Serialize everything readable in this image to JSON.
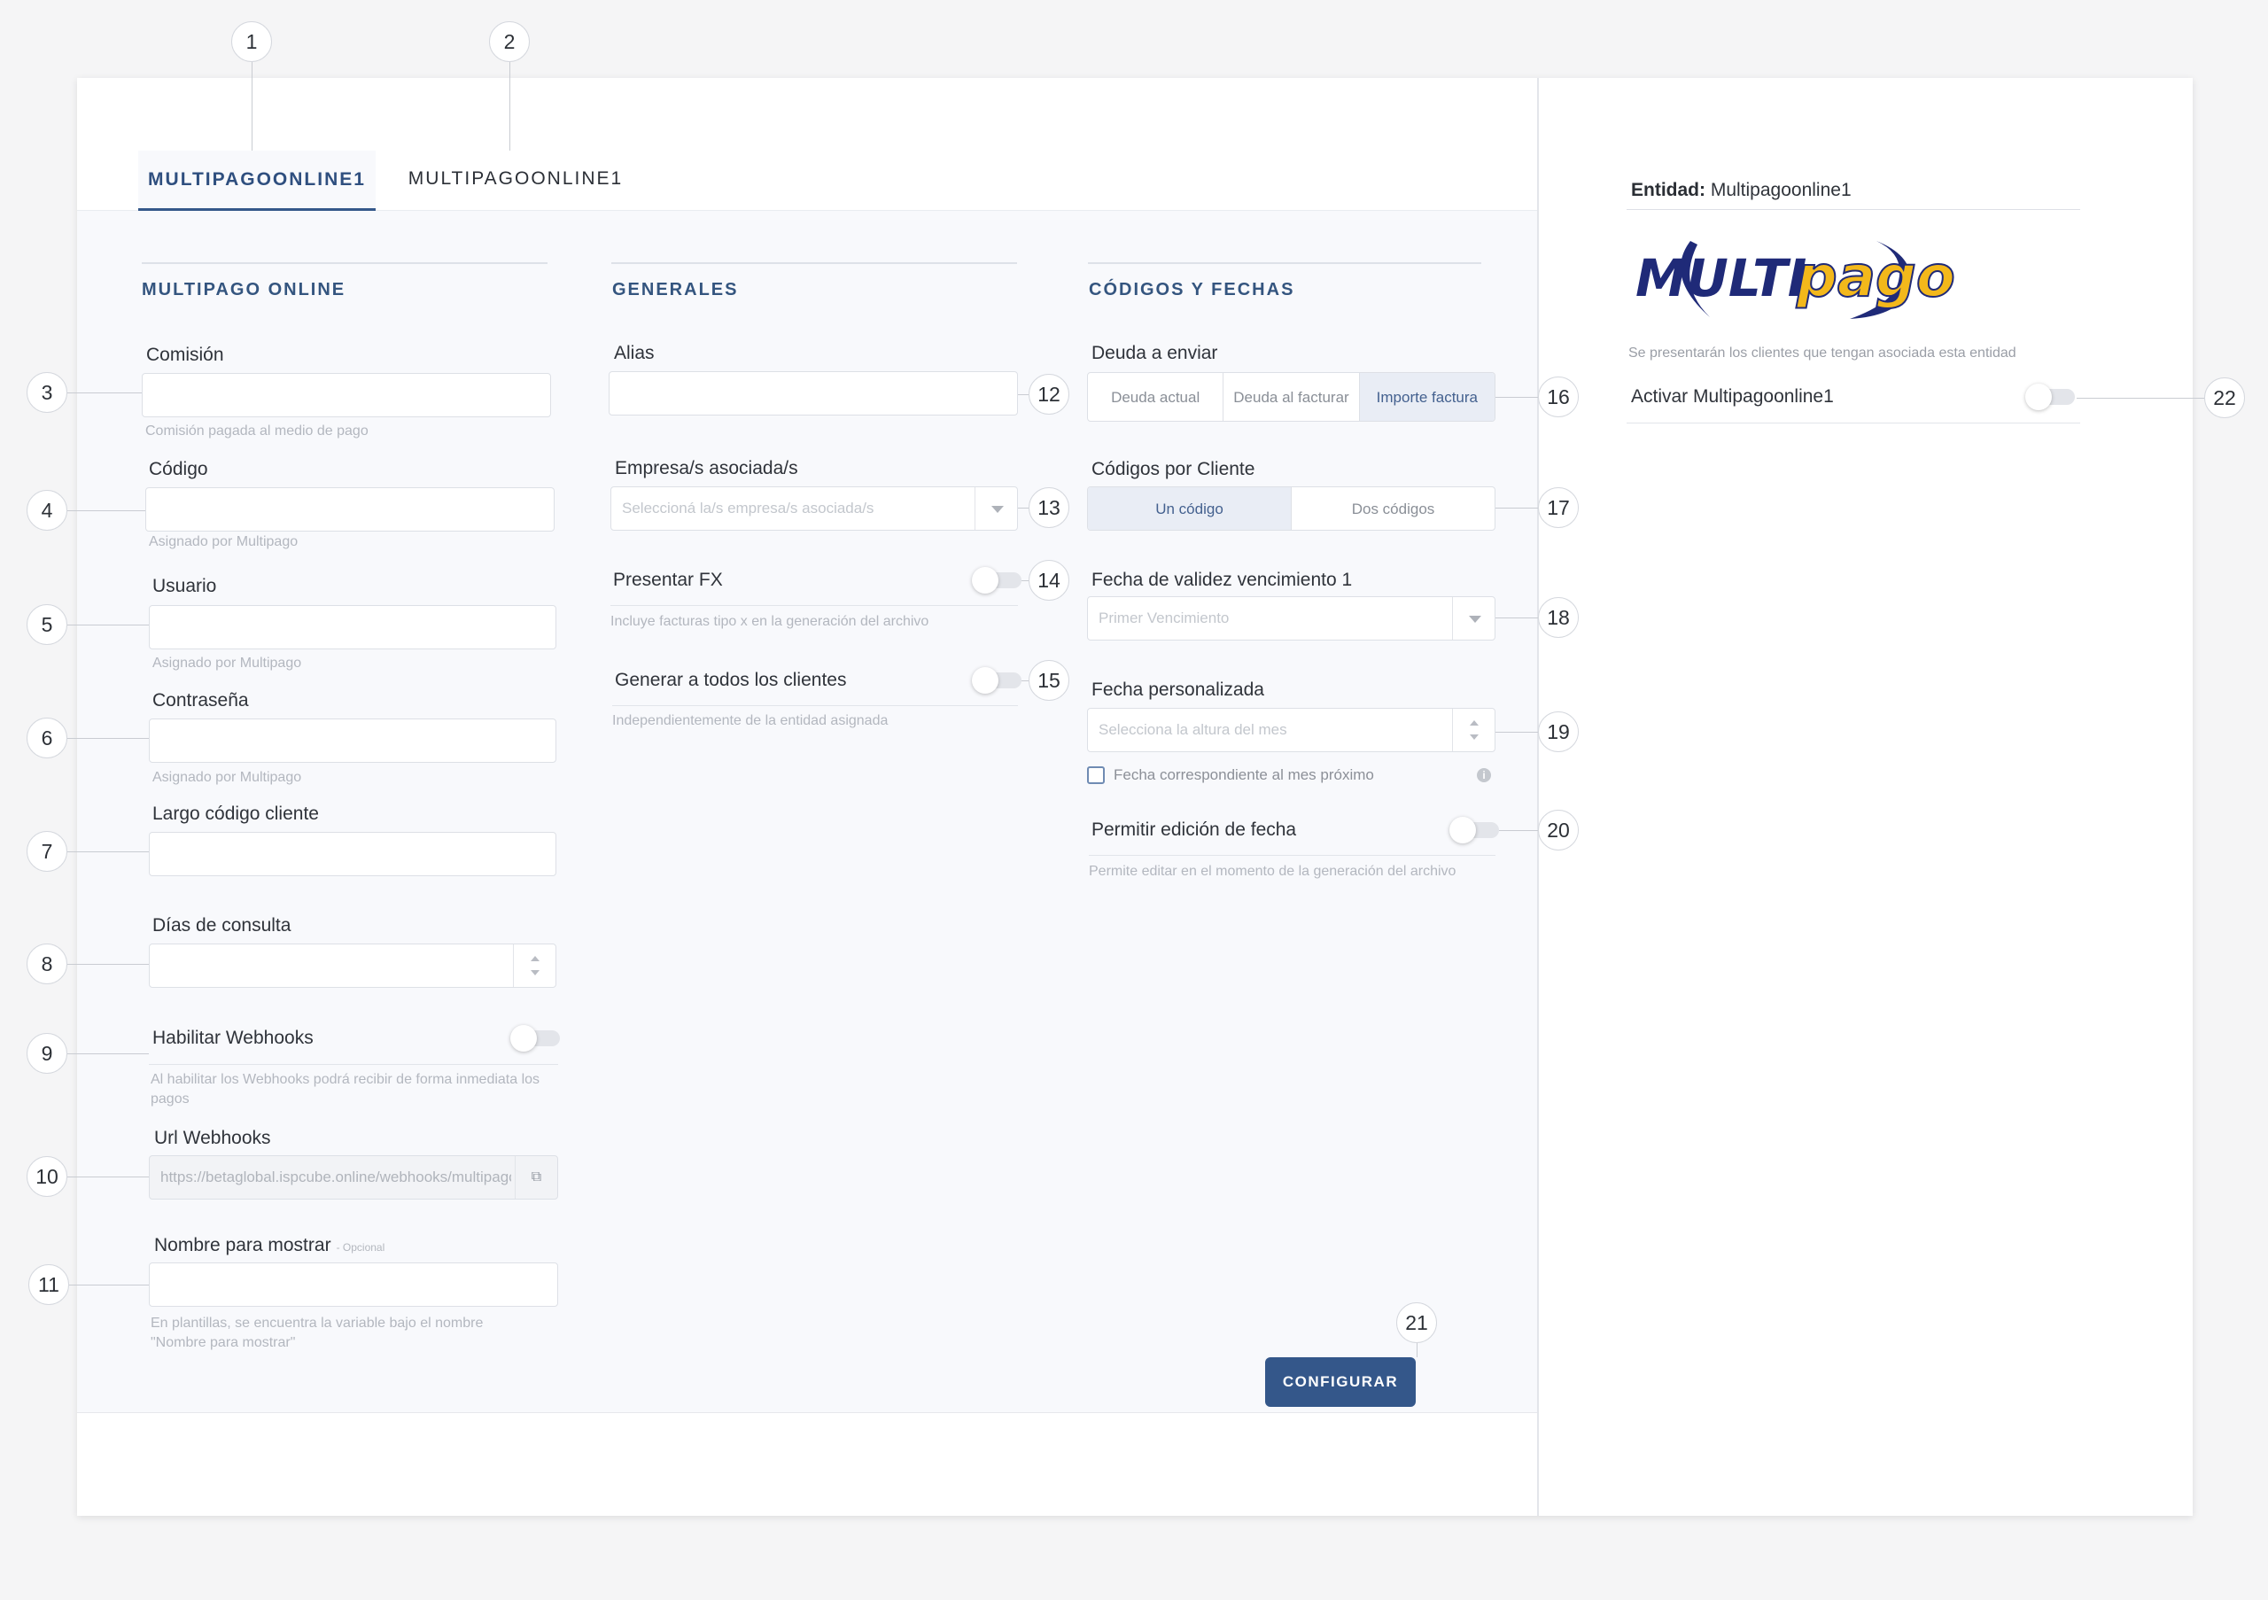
{
  "tabs": [
    {
      "label": "MULTIPAGOONLINE1"
    },
    {
      "label": "MULTIPAGOONLINE1"
    }
  ],
  "multipago_online": {
    "title": "MULTIPAGO ONLINE",
    "comision": {
      "label": "Comisión",
      "help": "Comisión pagada al medio de pago"
    },
    "codigo": {
      "label": "Código",
      "help": "Asignado por Multipago"
    },
    "usuario": {
      "label": "Usuario",
      "help": "Asignado por Multipago"
    },
    "contrasena": {
      "label": "Contraseña",
      "help": "Asignado por Multipago"
    },
    "largo_codigo": {
      "label": "Largo código cliente"
    },
    "dias_consulta": {
      "label": "Días de consulta"
    },
    "webhooks": {
      "label": "Habilitar Webhooks",
      "help": "Al habilitar los Webhooks podrá recibir de forma inmediata los pagos"
    },
    "url_webhooks": {
      "label": "Url Webhooks",
      "value": "https://betaglobal.ispcube.online/webhooks/multipago"
    },
    "nombre_mostrar": {
      "label": "Nombre para mostrar",
      "optional": "- Opcional",
      "help": "En plantillas, se encuentra la variable bajo el nombre \"Nombre para mostrar\""
    }
  },
  "generales": {
    "title": "GENERALES",
    "alias": {
      "label": "Alias"
    },
    "empresas": {
      "label": "Empresa/s asociada/s",
      "placeholder": "Seleccioná la/s empresa/s asociada/s"
    },
    "presentar_fx": {
      "label": "Presentar FX",
      "help": "Incluye facturas tipo x en la generación del archivo"
    },
    "generar_todos": {
      "label": "Generar a todos los clientes",
      "help": "Independientemente de la entidad asignada"
    }
  },
  "codigos_fechas": {
    "title": "CÓDIGOS Y FECHAS",
    "deuda": {
      "label": "Deuda a enviar",
      "options": [
        "Deuda actual",
        "Deuda al facturar",
        "Importe factura"
      ],
      "selected": "Importe factura"
    },
    "codigos_cliente": {
      "label": "Códigos por Cliente",
      "options": [
        "Un código",
        "Dos códigos"
      ],
      "selected": "Un código"
    },
    "fecha_validez": {
      "label": "Fecha de validez vencimiento 1",
      "placeholder": "Primer Vencimiento"
    },
    "fecha_personalizada": {
      "label": "Fecha personalizada",
      "placeholder": "Selecciona la altura del mes"
    },
    "mes_proximo": {
      "label": "Fecha correspondiente al mes próximo"
    },
    "edicion_fecha": {
      "label": "Permitir edición de fecha",
      "help": "Permite editar en el momento de la generación del archivo"
    }
  },
  "footer": {
    "configurar": "CONFIGURAR"
  },
  "side": {
    "entidad_label": "Entidad:",
    "entidad_value": "Multipagoonline1",
    "logo_left": "MULTI",
    "logo_right": "pago",
    "note": "Se presentarán los clientes que tengan asociada esta entidad",
    "activar": "Activar Multipagoonline1"
  },
  "callouts": [
    "1",
    "2",
    "3",
    "4",
    "5",
    "6",
    "7",
    "8",
    "9",
    "10",
    "11",
    "12",
    "13",
    "14",
    "15",
    "16",
    "17",
    "18",
    "19",
    "20",
    "21",
    "22"
  ],
  "colors": {
    "accent": "#34578a",
    "logo_blue": "#1f2a78",
    "logo_yellow": "#f3b81b"
  }
}
